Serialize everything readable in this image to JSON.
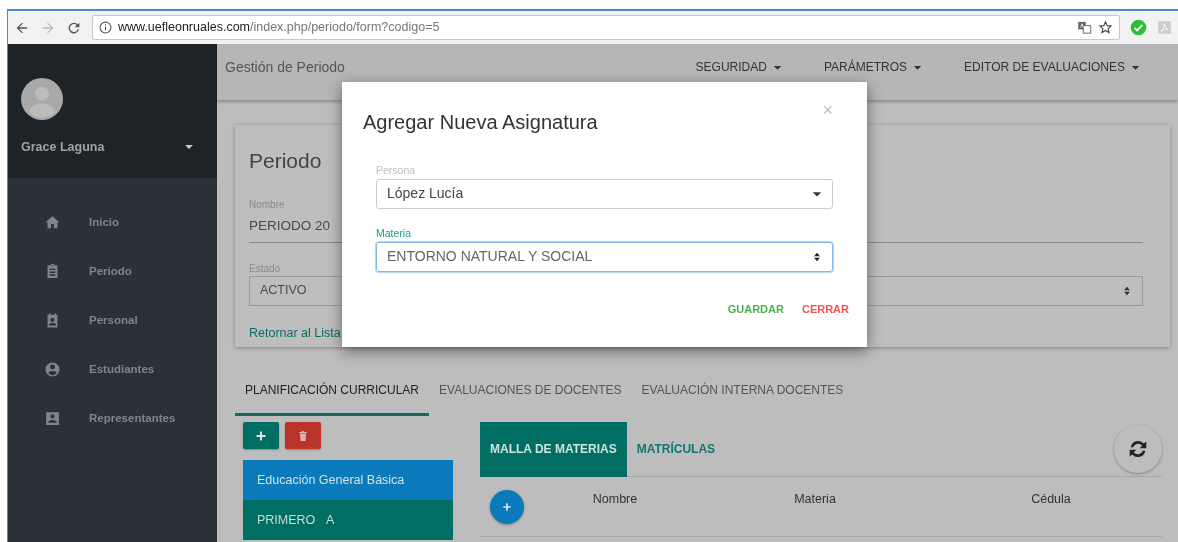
{
  "browser": {
    "url": {
      "host": "www.uefleonruales.com",
      "path": "/index.php/periodo/form?codigo=5"
    }
  },
  "sidebar": {
    "user": "Grace Laguna",
    "items": [
      {
        "label": "Inicio"
      },
      {
        "label": "Periodo"
      },
      {
        "label": "Personal"
      },
      {
        "label": "Estudiantes"
      },
      {
        "label": "Representantes"
      }
    ]
  },
  "header": {
    "title": "Gestión de Periodo",
    "menus": [
      {
        "label": "SEGURIDAD"
      },
      {
        "label": "PARÁMETROS"
      },
      {
        "label": "EDITOR DE EVALUACIONES"
      }
    ]
  },
  "card": {
    "title": "Periodo",
    "fields": [
      {
        "kind": "text",
        "label": "Nombre",
        "value": "PERIODO 20"
      },
      {
        "kind": "select",
        "label": "Estado",
        "value": "ACTIVO"
      }
    ],
    "link": "Retornar al Lista"
  },
  "tabs": [
    {
      "label": "PLANIFICACIÓN CURRICULAR",
      "selected": true
    },
    {
      "label": "EVALUACIONES DE DOCENTES",
      "selected": false
    },
    {
      "label": "EVALUACIÓN INTERNA DOCENTES",
      "selected": false
    }
  ],
  "levels": [
    {
      "kind": "group",
      "label": "Educación General Básica"
    },
    {
      "kind": "item",
      "label": "PRIMERO A"
    }
  ],
  "subtabs": [
    {
      "label": "MALLA DE MATERIAS",
      "selected": true
    },
    {
      "label": "MATRÍCULAS",
      "selected": false
    }
  ],
  "table": {
    "columns": [
      "Nombre",
      "Materia",
      "Cédula"
    ]
  },
  "modal": {
    "title": "Agregar Nueva Asignatura",
    "close": "×",
    "fields": [
      {
        "kind": "dropdown",
        "label": "Persona",
        "value": "López Lucía",
        "focused": false
      },
      {
        "kind": "select",
        "label": "Materia",
        "value": "ENTORNO NATURAL Y SOCIAL",
        "focused": true
      }
    ],
    "buttons": [
      {
        "kind": "save",
        "label": "GUARDAR"
      },
      {
        "kind": "close",
        "label": "CERRAR"
      }
    ]
  }
}
